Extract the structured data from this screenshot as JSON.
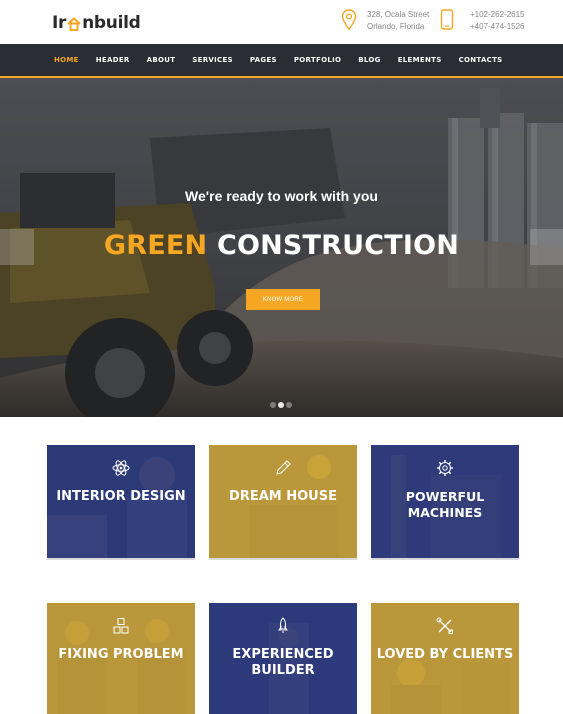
{
  "brand": {
    "logo_text_left": "Ir",
    "logo_text_right": "nbuild",
    "accent": "#f5a623",
    "nav_bg": "#2a2d33"
  },
  "contact": {
    "address_line1": "328, Ocala Street",
    "address_line2": "Orlando, Florida",
    "phone1": "+102-262-2615",
    "phone2": "+407-474-1526",
    "address_icon": "map-pin-icon",
    "phone_icon": "phone-icon"
  },
  "nav": {
    "items": [
      {
        "label": "HOME",
        "active": true
      },
      {
        "label": "HEADER"
      },
      {
        "label": "ABOUT"
      },
      {
        "label": "SERVICES"
      },
      {
        "label": "PAGES"
      },
      {
        "label": "PORTFOLIO"
      },
      {
        "label": "BLOG"
      },
      {
        "label": "ELEMENTS"
      },
      {
        "label": "CONTACTS"
      }
    ]
  },
  "hero": {
    "subtitle": "We're ready to work with you",
    "title_highlight": "GREEN",
    "title_rest": "CONSTRUCTION",
    "button": "KNOW MORE",
    "slides_count": 3,
    "active_slide": 2
  },
  "services": [
    {
      "label": "INTERIOR DESIGN",
      "icon": "atom-icon",
      "tone": "blue"
    },
    {
      "label": "DREAM HOUSE",
      "icon": "pencil-icon",
      "tone": "gold"
    },
    {
      "label": "POWERFUL MACHINES",
      "icon": "gear-icon",
      "tone": "blue"
    },
    {
      "label": "FIXING PROBLEM",
      "icon": "blocks-icon",
      "tone": "gold"
    },
    {
      "label": "EXPERIENCED BUILDER",
      "icon": "rocket-icon",
      "tone": "blue"
    },
    {
      "label": "LOVED BY CLIENTS",
      "icon": "tools-icon",
      "tone": "gold"
    }
  ]
}
